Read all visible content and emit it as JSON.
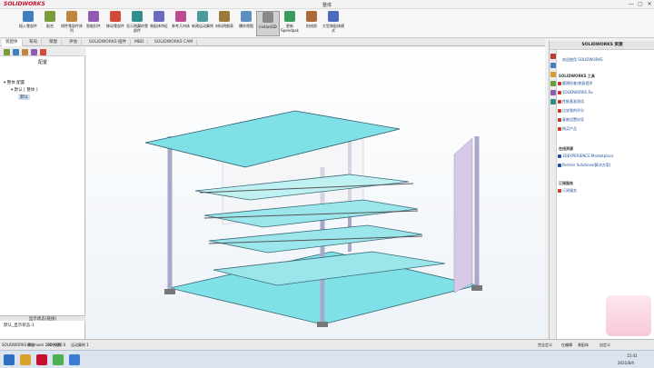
{
  "app": {
    "logo": "SOLIDWORKS",
    "document_title": "整体"
  },
  "window_controls": {
    "minimize": "—",
    "maximize": "▢",
    "close": "✕"
  },
  "ribbon": {
    "buttons": [
      {
        "label": "插入零部件",
        "icon": "insert-component-icon"
      },
      {
        "label": "配合",
        "icon": "mate-icon"
      },
      {
        "label": "线性零部件阵列",
        "icon": "linear-pattern-icon"
      },
      {
        "label": "智能扣件",
        "icon": "smart-fastener-icon"
      },
      {
        "label": "移动零部件",
        "icon": "move-component-icon"
      },
      {
        "label": "显示隐藏的零部件",
        "icon": "show-hidden-icon"
      },
      {
        "label": "装配体特征",
        "icon": "assembly-feature-icon"
      },
      {
        "label": "参考几何体",
        "icon": "reference-geometry-icon"
      },
      {
        "label": "新建运动算例",
        "icon": "motion-study-icon"
      },
      {
        "label": "材料明细表",
        "icon": "bom-icon"
      },
      {
        "label": "爆炸视图",
        "icon": "explode-view-icon"
      },
      {
        "label": "Instant3D",
        "icon": "instant3d-icon"
      },
      {
        "label": "更新Speedpak",
        "icon": "speedpak-icon"
      },
      {
        "label": "拍快照",
        "icon": "snapshot-icon"
      },
      {
        "label": "大型装配体模式",
        "icon": "large-assembly-icon"
      }
    ]
  },
  "tabs": [
    "装配体",
    "布局",
    "草图",
    "评估",
    "SOLIDWORKS 插件",
    "MBD",
    "SOLIDWORKS CAM"
  ],
  "left_panel": {
    "title": "配置",
    "tree": [
      {
        "label": "整体 配置"
      },
      {
        "label": "默认 [ 整体 ]"
      },
      {
        "label": "默认"
      }
    ],
    "display_state_header": "显示状态(链接)",
    "display_state_item": "默认_显示状态-1"
  },
  "right_panel": {
    "title": "SOLIDWORKS 资源",
    "welcome": "欢迎使用 SOLIDWORKS",
    "sections": [
      {
        "title": "SOLIDWORKS 工具",
        "links": [
          "重建检查/修复程序",
          "SOLIDWORKS Rx",
          "性能基准测试",
          "比较我的评分",
          "复制设置向导",
          "购买产品"
        ]
      },
      {
        "title": "在线资源",
        "links": [
          "3DEXPERIENCE Marketplace",
          "Partner Solutions(解决方案)"
        ]
      },
      {
        "title": "订阅服务",
        "links": [
          "订阅服务"
        ]
      }
    ]
  },
  "status_bar": {
    "app_version": "SOLIDWORKS Premium 2019 SP0.0",
    "bottom_tabs": [
      "模型",
      "3D 视图",
      "运动算例 1"
    ],
    "status_right": [
      "完全定义",
      "在编辑",
      "装配体",
      "自定义"
    ]
  },
  "taskbar": {
    "time": "15:41",
    "date": "2021/8/4"
  }
}
